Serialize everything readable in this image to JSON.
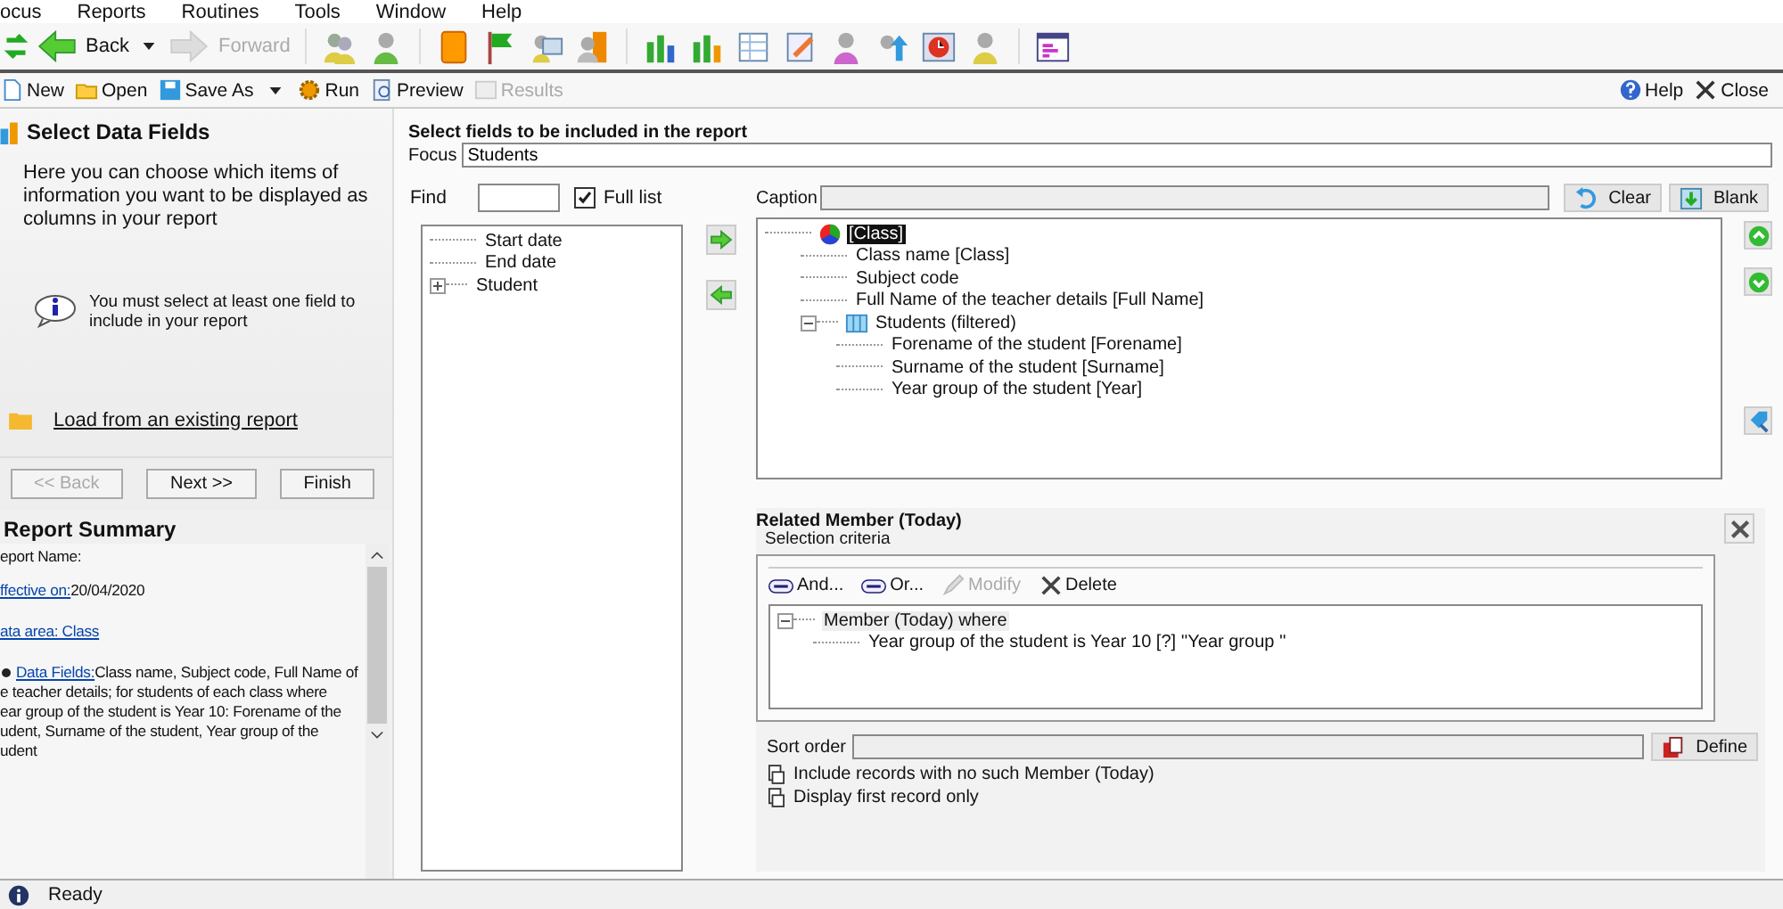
{
  "menu": [
    "ocus",
    "Reports",
    "Routines",
    "Tools",
    "Window",
    "Help"
  ],
  "nav": [
    {
      "label": "Back",
      "kind": "back",
      "disabled": false
    },
    {
      "label": "Forward",
      "kind": "forward",
      "disabled": true
    }
  ],
  "toolbar": [
    {
      "label": "New",
      "kind": "new",
      "disabled": false
    },
    {
      "label": "Open",
      "kind": "open",
      "disabled": false
    },
    {
      "label": "Save As",
      "kind": "save",
      "disabled": false
    },
    {
      "label": "Run",
      "kind": "run",
      "disabled": false
    },
    {
      "label": "Preview",
      "kind": "preview",
      "disabled": false
    },
    {
      "label": "Results",
      "kind": "results",
      "disabled": true
    }
  ],
  "help_buttons": [
    {
      "label": "Help",
      "kind": "help"
    },
    {
      "label": "Close",
      "kind": "close"
    }
  ],
  "wizard": {
    "title": "Select Data Fields",
    "description": "Here you can choose which items of information you want to be displayed as columns in your report",
    "info": "You must select at least one field to include in your report",
    "load_link": "Load from an existing report",
    "buttons": [
      {
        "label": "<< Back",
        "disabled": true
      },
      {
        "label": "Next >>",
        "disabled": false
      },
      {
        "label": "Finish",
        "disabled": false
      }
    ]
  },
  "summary": {
    "title": "Report Summary",
    "items": [
      {
        "kind": "plain",
        "text": "eport Name:"
      },
      {
        "kind": "plain",
        "link": "ffective on:",
        "text": " 20/04/2020"
      },
      {
        "kind": "plain",
        "link": "ata area: Class"
      },
      {
        "kind": "bulleted",
        "link": "Data Fields:",
        "text": " Class name, Subject code, Full Name of",
        "lines": [
          "e teacher details; for students of each class where",
          "ear group of the student is Year 10: Forename of the",
          "udent, Surname of the student, Year group of the",
          "udent"
        ]
      }
    ]
  },
  "fields": {
    "heading": "Select fields to be included in the report",
    "focus_label": "Focus",
    "focus_value": "Students",
    "find_label": "Find",
    "full_list": {
      "label": "Full list",
      "checked": true
    },
    "available": [
      {
        "label": "Start date"
      },
      {
        "label": "End date"
      },
      {
        "label": "Student",
        "expanded": false
      }
    ],
    "caption_label": "Caption",
    "clear": "Clear",
    "blank": "Blank",
    "selected_tree": [
      {
        "label": "[Class]",
        "kind": "class",
        "selected": true,
        "children": [
          {
            "label": "Class name [Class]",
            "selected": false
          },
          {
            "label": "Subject code",
            "selected": false
          },
          {
            "label": "Full Name of the teacher details [Full Name]",
            "selected": false
          },
          {
            "label": "Students (filtered)",
            "kind": "table",
            "selected": false,
            "expanded": true,
            "children": [
              {
                "label": "Forename of the student [Forename]",
                "selected": false
              },
              {
                "label": "Surname of the student [Surname]",
                "selected": false
              },
              {
                "label": "Year group of the student [Year]",
                "selected": false
              }
            ]
          }
        ]
      }
    ]
  },
  "related": {
    "title": "Related Member (Today)",
    "subtitle": "Selection criteria",
    "actions": [
      {
        "label": "And...",
        "kind": "and",
        "disabled": false
      },
      {
        "label": "Or...",
        "kind": "or",
        "disabled": false
      },
      {
        "label": "Modify",
        "kind": "modify",
        "disabled": true
      },
      {
        "label": "Delete",
        "kind": "delete",
        "disabled": false
      }
    ],
    "criteria": [
      {
        "label": "Member (Today) where",
        "kind": "group",
        "expanded": true,
        "children": [
          {
            "label": "Year group of the student is Year 10 [?] ''Year group ''"
          }
        ]
      }
    ],
    "sort_label": "Sort order",
    "define": "Define",
    "options": [
      "Include records with no such Member (Today)",
      "Display first record only"
    ]
  },
  "status": "Ready"
}
